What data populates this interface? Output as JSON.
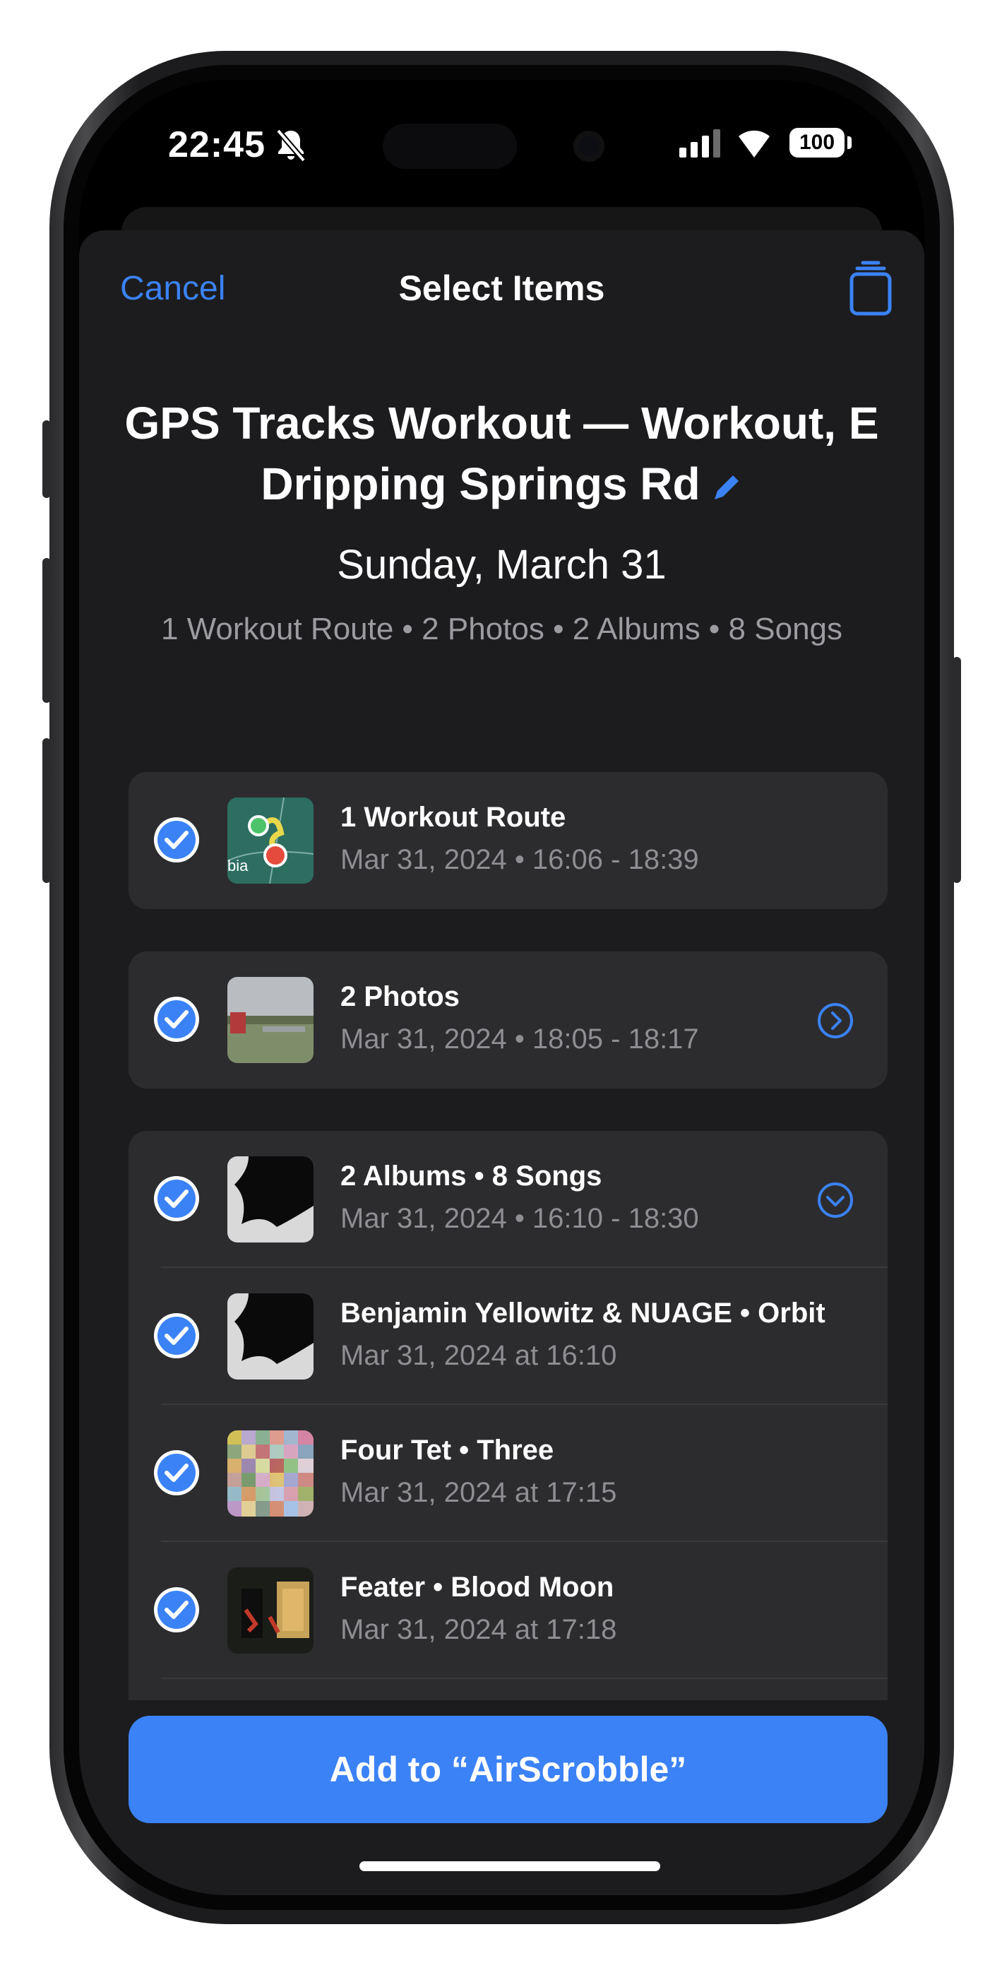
{
  "status": {
    "time": "22:45",
    "battery": "100"
  },
  "nav": {
    "cancel": "Cancel",
    "title": "Select Items"
  },
  "header": {
    "title_line1": "GPS Tracks Workout — Workout, E",
    "title_line2": "Dripping Springs Rd",
    "date": "Sunday, March 31",
    "summary": "1 Workout Route • 2 Photos • 2 Albums • 8 Songs"
  },
  "items": [
    {
      "title": "1 Workout Route",
      "subtitle": "Mar 31, 2024 • 16:06 - 18:39",
      "thumb_text": "bia"
    },
    {
      "title": "2 Photos",
      "subtitle": "Mar 31, 2024 • 18:05 - 18:17"
    },
    {
      "title": "2 Albums • 8 Songs",
      "subtitle": "Mar 31, 2024 • 16:10 - 18:30"
    },
    {
      "title": "Benjamin Yellowitz & NUAGE • Orbit",
      "subtitle": "Mar 31, 2024 at 16:10"
    },
    {
      "title": "Four Tet • Three",
      "subtitle": "Mar 31, 2024 at 17:15"
    },
    {
      "title": "Feater • Blood Moon",
      "subtitle": "Mar 31, 2024 at 17:18"
    }
  ],
  "actions": {
    "add": "Add to “AirScrobble”"
  },
  "colors": {
    "accent": "#3b82f6",
    "card": "#2c2c2e",
    "sheet": "#1c1c1e"
  },
  "icons": [
    "bell-slash-icon",
    "signal-icon",
    "wifi-icon",
    "battery-icon",
    "trash-icon",
    "pencil-icon",
    "checkmark-icon",
    "chevron-right-icon",
    "chevron-down-icon"
  ]
}
